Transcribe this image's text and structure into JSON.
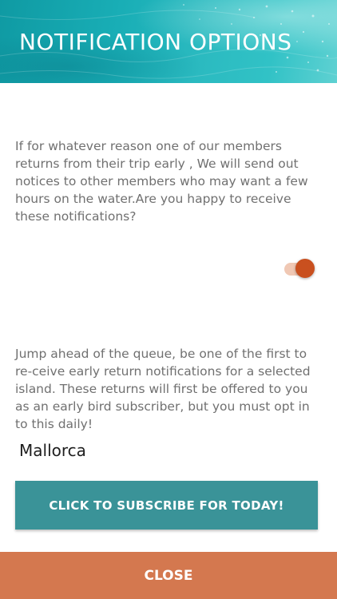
{
  "header": {
    "title": "NOTIFICATION OPTIONS"
  },
  "early_return": {
    "description": "If for whatever reason one of our members returns from their trip early , We will send out notices to other members who may want a few hours on the water.Are you happy to receive these notifications?",
    "toggle_on": true
  },
  "priority": {
    "description": "Jump ahead of the queue, be one of the first to re-ceive early return notifications for a selected island. These returns will first be offered to you as an early bird subscriber, but you must opt in to this daily!",
    "selected_island": "Mallorca",
    "subscribe_label": "CLICK TO SUBSCRIBE FOR TODAY!"
  },
  "footer": {
    "close_label": "CLOSE"
  },
  "colors": {
    "header_teal": "#19aeb6",
    "toggle_thumb": "#c9501f",
    "toggle_track": "#f0c8b4",
    "subscribe_button": "#3a9398",
    "close_bar": "#d4784f",
    "body_text": "#707070"
  }
}
